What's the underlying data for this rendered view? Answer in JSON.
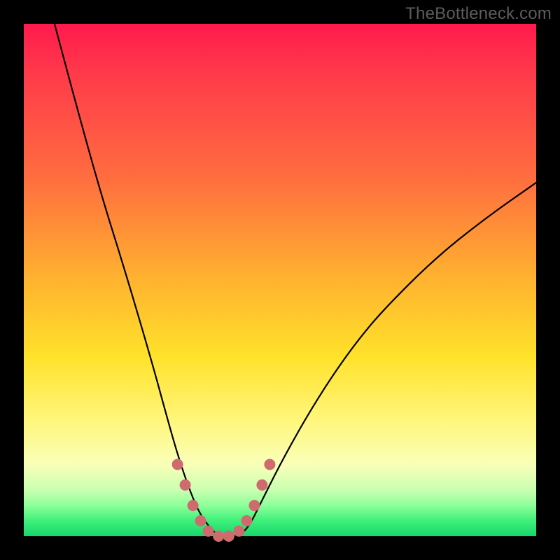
{
  "watermark": "TheBottleneck.com",
  "colors": {
    "frame": "#000000",
    "curve_stroke": "#000000",
    "marker_fill": "#cf6a6e",
    "gradient_stops": [
      "#ff1a4d",
      "#ff6d3f",
      "#ffe22a",
      "#f9ffb8",
      "#3ef07a",
      "#17d66a"
    ]
  },
  "chart_data": {
    "type": "line",
    "title": "",
    "xlabel": "",
    "ylabel": "",
    "xlim": [
      0,
      100
    ],
    "ylim": [
      0,
      100
    ],
    "series": [
      {
        "name": "bottleneck-curve",
        "x": [
          6,
          10,
          15,
          20,
          25,
          28,
          30,
          32,
          34,
          36,
          38,
          40,
          42,
          44,
          46,
          50,
          55,
          60,
          65,
          70,
          80,
          90,
          100
        ],
        "y": [
          100,
          85,
          67,
          51,
          34,
          23,
          16,
          10,
          5,
          2,
          0,
          0,
          0,
          2,
          6,
          14,
          23,
          31,
          38,
          44,
          54,
          62,
          69
        ]
      }
    ],
    "markers": {
      "name": "valley-markers",
      "x": [
        30,
        31.5,
        33,
        34.5,
        36,
        38,
        40,
        42,
        43.5,
        45,
        46.5,
        48
      ],
      "y": [
        14,
        10,
        6,
        3,
        1,
        0,
        0,
        1,
        3,
        6,
        10,
        14
      ]
    }
  }
}
